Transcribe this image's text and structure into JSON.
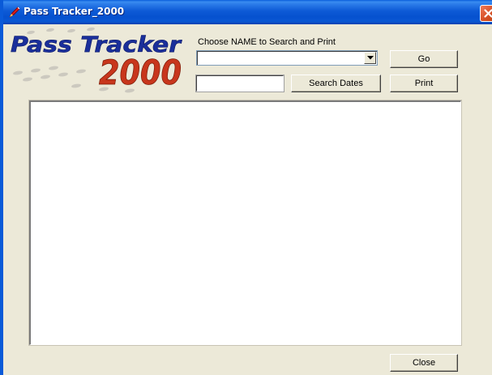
{
  "window": {
    "title": "Pass Tracker_2000"
  },
  "logo": {
    "line1": "Pass Tracker",
    "line2": "2000"
  },
  "search": {
    "prompt_label": "Choose NAME to Search and Print",
    "name_value": "",
    "date_value": ""
  },
  "buttons": {
    "go": "Go",
    "search_dates": "Search Dates",
    "print": "Print",
    "close": "Close"
  },
  "results": {
    "content": ""
  },
  "icons": {
    "app": "pen-icon",
    "window_close": "close-icon",
    "dropdown": "chevron-down-icon"
  },
  "colors": {
    "titlebar": "#0a5ad8",
    "window_bg": "#ece9d8",
    "logo_blue": "#1a2f9b",
    "logo_red": "#c8361c",
    "close_button": "#d8532a"
  }
}
